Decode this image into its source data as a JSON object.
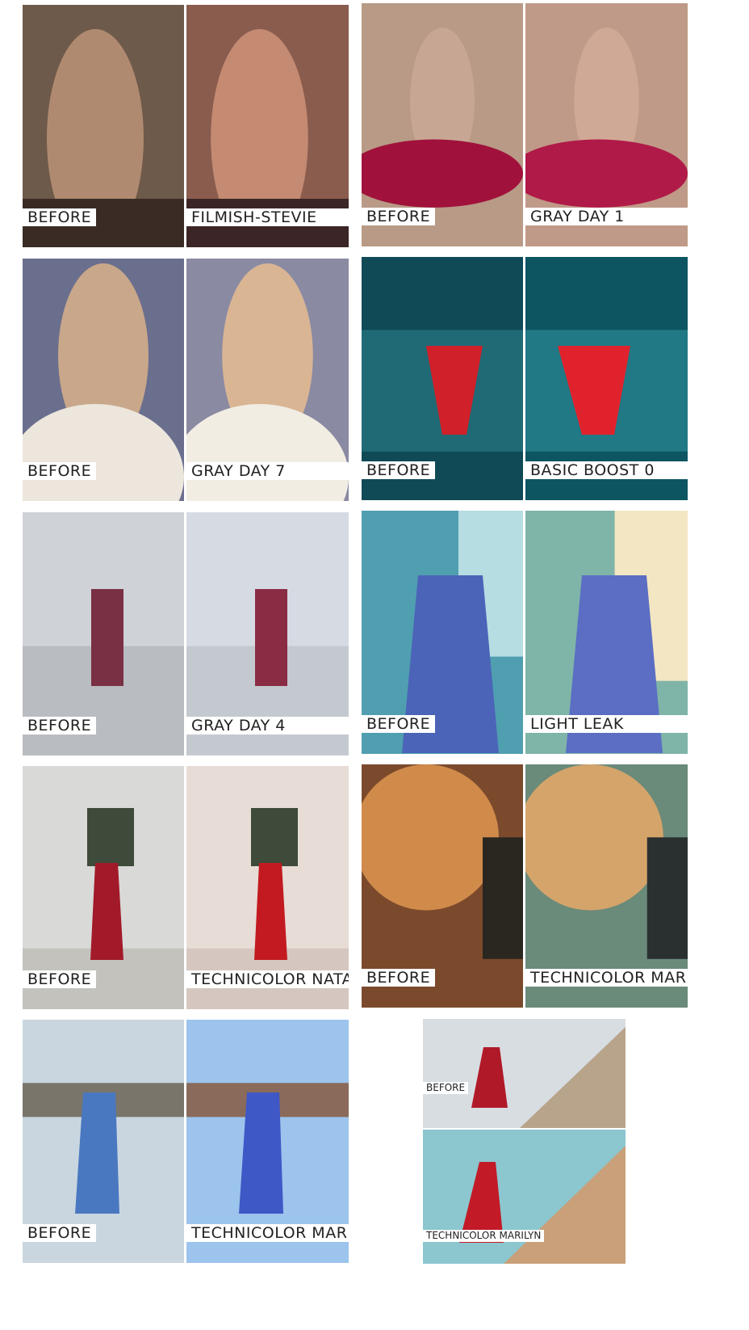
{
  "panels": [
    {
      "before_label": "BEFORE",
      "after_label": "FILMISH-STEVIE",
      "before_colors": [
        "#6e5a4a",
        "#b08a70",
        "#3a2c25"
      ],
      "after_colors": [
        "#8a5c4e",
        "#c48a72",
        "#3c2526"
      ]
    },
    {
      "before_label": "BEFORE",
      "after_label": "GRAY DAY 1",
      "before_colors": [
        "#b89a86",
        "#c7a793",
        "#a0123c"
      ],
      "after_colors": [
        "#c09a88",
        "#d0a996",
        "#b01a48"
      ]
    },
    {
      "before_label": "BEFORE",
      "after_label": "GRAY DAY 7",
      "before_colors": [
        "#6b6f8e",
        "#c9a78a",
        "#ece6dc"
      ],
      "after_colors": [
        "#8a8aa2",
        "#d9b594",
        "#f2ede3"
      ]
    },
    {
      "before_label": "BEFORE",
      "after_label": "BASIC BOOST 0",
      "before_colors": [
        "#0f4a56",
        "#1f6a75",
        "#d0202a"
      ],
      "after_colors": [
        "#0e5562",
        "#217985",
        "#e0222c"
      ]
    },
    {
      "before_label": "BEFORE",
      "after_label": "GRAY DAY 4",
      "before_colors": [
        "#cfd3d8",
        "#b9bcc0",
        "#7a3044"
      ],
      "after_colors": [
        "#d6dbe3",
        "#c4c8cf",
        "#8a2c44"
      ]
    },
    {
      "before_label": "BEFORE",
      "after_label": "LIGHT LEAK",
      "before_colors": [
        "#4f9fb0",
        "#b6dde2",
        "#4b64b8"
      ],
      "after_colors": [
        "#7fb4a8",
        "#f3e6c2",
        "#5b6ec4"
      ]
    },
    {
      "before_label": "BEFORE",
      "after_label": "TECHNICOLOR NATALIE",
      "before_colors": [
        "#d9d9d7",
        "#c4c2bd",
        "#a21a2a"
      ],
      "after_colors": [
        "#e7dcd6",
        "#d5c7bf",
        "#c21a20"
      ]
    },
    {
      "before_label": "BEFORE",
      "after_label": "TECHNICOLOR MARILYN",
      "before_colors": [
        "#7b4a2c",
        "#d08a4a",
        "#2a2620"
      ],
      "after_colors": [
        "#6a8a7a",
        "#d4a46a",
        "#2a3030"
      ]
    },
    {
      "before_label": "BEFORE",
      "after_label": "TECHNICOLOR MARILYN",
      "before_colors": [
        "#c9d6e0",
        "#7a756b",
        "#4a78c0"
      ],
      "after_colors": [
        "#9cc4ec",
        "#8a6a5a",
        "#3e58c6"
      ]
    }
  ],
  "stacked_panel": {
    "before_label": "BEFORE",
    "after_label": "TECHNICOLOR MARILYN",
    "before_colors": [
      "#d8dde2",
      "#b7a48a",
      "#b01a28"
    ],
    "after_colors": [
      "#8cc6cf",
      "#c9a07a",
      "#c21a26"
    ]
  }
}
